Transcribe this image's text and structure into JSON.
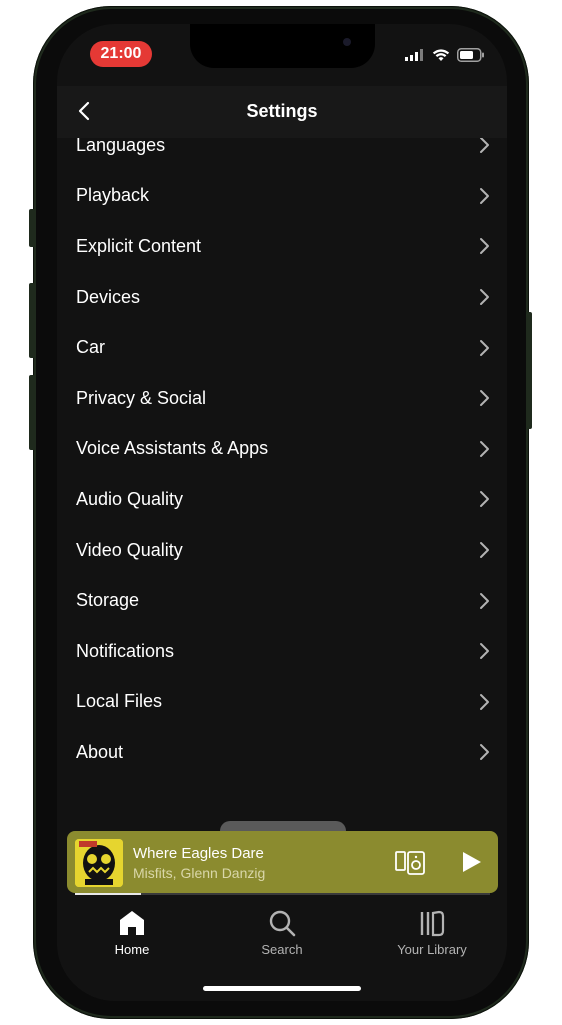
{
  "status_bar": {
    "time": "21:00",
    "time_pill_color": "#e53935",
    "icons": [
      "cellular-signal-icon",
      "wifi-icon",
      "battery-icon"
    ]
  },
  "header": {
    "title": "Settings",
    "back_icon": "chevron-left-icon"
  },
  "settings": {
    "items": [
      {
        "label": "Languages",
        "icon": "chevron-right-icon"
      },
      {
        "label": "Playback",
        "icon": "chevron-right-icon"
      },
      {
        "label": "Explicit Content",
        "icon": "chevron-right-icon"
      },
      {
        "label": "Devices",
        "icon": "chevron-right-icon"
      },
      {
        "label": "Car",
        "icon": "chevron-right-icon"
      },
      {
        "label": "Privacy & Social",
        "icon": "chevron-right-icon"
      },
      {
        "label": "Voice Assistants & Apps",
        "icon": "chevron-right-icon"
      },
      {
        "label": "Audio Quality",
        "icon": "chevron-right-icon"
      },
      {
        "label": "Video Quality",
        "icon": "chevron-right-icon"
      },
      {
        "label": "Storage",
        "icon": "chevron-right-icon"
      },
      {
        "label": "Notifications",
        "icon": "chevron-right-icon"
      },
      {
        "label": "Local Files",
        "icon": "chevron-right-icon"
      },
      {
        "label": "About",
        "icon": "chevron-right-icon"
      }
    ]
  },
  "now_playing": {
    "title": "Where Eagles Dare",
    "artist": "Misfits, Glenn Danzig",
    "background_color": "#8b8b2f",
    "progress_fraction": 0.16,
    "icons": [
      "album-art",
      "devices-icon",
      "play-icon"
    ]
  },
  "tabbar": {
    "tabs": [
      {
        "label": "Home",
        "icon": "home-icon",
        "active": true
      },
      {
        "label": "Search",
        "icon": "search-icon",
        "active": false
      },
      {
        "label": "Your Library",
        "icon": "library-icon",
        "active": false
      }
    ]
  },
  "colors": {
    "background": "#121212",
    "text": "#ffffff",
    "muted_text": "#b3b3b3"
  }
}
